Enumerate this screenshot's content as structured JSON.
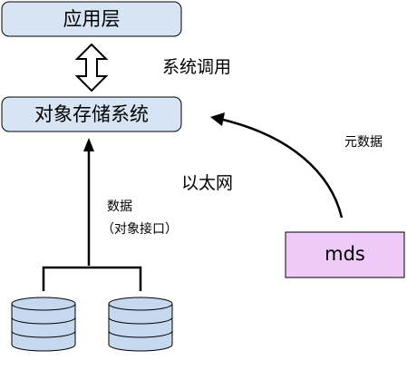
{
  "boxes": {
    "app_layer": "应用层",
    "object_storage": "对象存储系统",
    "mds": "mds"
  },
  "labels": {
    "system_call": "系统调用",
    "metadata": "元数据",
    "ethernet": "以太网",
    "data": "数据",
    "object_interface": "（对象接口）"
  },
  "colors": {
    "layer_fill": "#d7e4f3",
    "mds_fill": "#eecaf8",
    "disk_fill": "#c5d8ee",
    "stroke": "#000000"
  }
}
